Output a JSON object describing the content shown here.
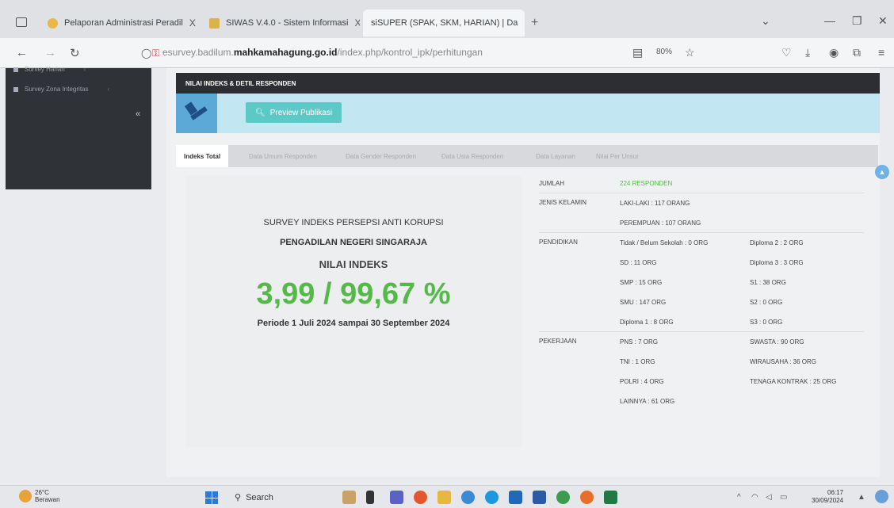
{
  "browser": {
    "tabs": [
      {
        "label": "Pelaporan Administrasi Peradil",
        "close": "X",
        "active": false
      },
      {
        "label": "SIWAS V.4.0 - Sistem Informasi",
        "close": "X",
        "active": false
      },
      {
        "label": "siSUPER (SPAK, SKM, HARIAN) | Da",
        "close": "X",
        "active": true
      }
    ],
    "new_tab": "+",
    "url_prefix": "esurvey.badilum.",
    "url_host": "mahkamahagung.go.id",
    "url_path": "/index.php/kontrol_ipk/perhitungan",
    "zoom": "80%"
  },
  "sidebar": {
    "items": [
      {
        "label": "Survey Harian"
      },
      {
        "label": "Survey Zona Integritas"
      }
    ],
    "collapse_icon": "«"
  },
  "card": {
    "header": "NILAI INDEKS & DETIL RESPONDEN",
    "preview_button": "Preview Publikasi",
    "tabs": [
      "Indeks Total",
      "Data Umum Responden",
      "Data Gender Responden",
      "Data Usia Responden",
      "Data Layanan",
      "Nilai Per Unsur"
    ]
  },
  "summary": {
    "survey_name": "SURVEY INDEKS PERSEPSI ANTI KORUPSI",
    "court": "PENGADILAN NEGERI SINGARAJA",
    "index_label": "NILAI INDEKS",
    "index_value": "3,99 / 99,67 %",
    "period": "Periode 1 Juli 2024 sampai 30 September 2024"
  },
  "details": {
    "jumlah_label": "JUMLAH",
    "jumlah_value": "224 RESPONDEN",
    "gender_label": "JENIS KELAMIN",
    "gender": [
      "LAKI-LAKI : 117 ORANG",
      "PEREMPUAN : 107 ORANG"
    ],
    "education_label": "PENDIDIKAN",
    "education_left": [
      "Tidak / Belum Sekolah : 0 ORG",
      "SD : 11 ORG",
      "SMP : 15 ORG",
      "SMU : 147 ORG",
      "Diploma 1 : 8 ORG"
    ],
    "education_right": [
      "Diploma 2 : 2 ORG",
      "Diploma 3 : 3 ORG",
      "S1 : 38 ORG",
      "S2 : 0 ORG",
      "S3 : 0 ORG"
    ],
    "job_label": "PEKERJAAN",
    "job_left": [
      "PNS : 7 ORG",
      "TNI : 1 ORG",
      "POLRI : 4 ORG",
      "LAINNYA : 61 ORG"
    ],
    "job_right": [
      "SWASTA : 90 ORG",
      "WIRAUSAHA : 36 ORG",
      "TENAGA KONTRAK : 25 ORG"
    ]
  },
  "taskbar": {
    "temperature": "26°C",
    "weather": "Berawan",
    "search": "Search",
    "time": "06:17",
    "date": "30/09/2024"
  }
}
